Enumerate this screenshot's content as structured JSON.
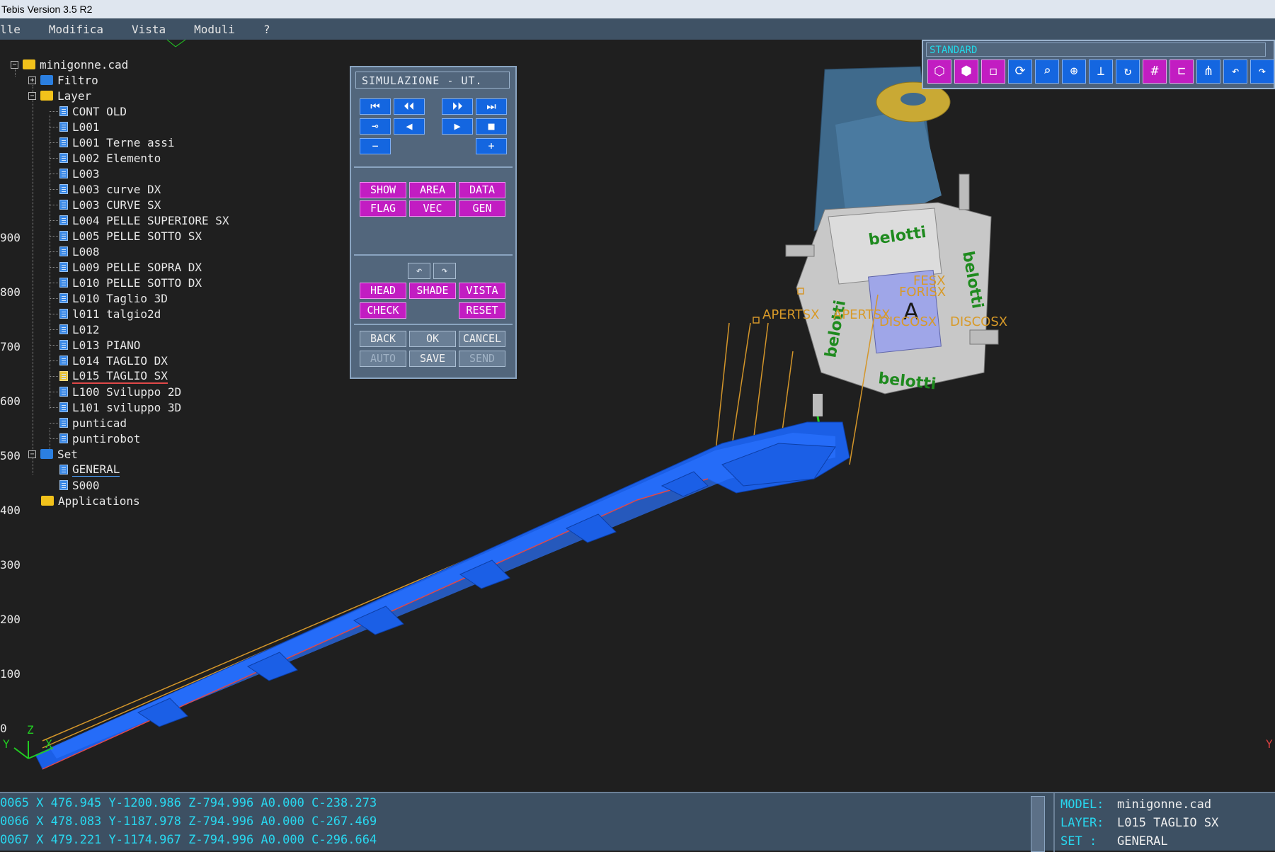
{
  "window": {
    "title": "Tebis Version 3.5 R2"
  },
  "menu": [
    "lle",
    "Modifica",
    "Vista",
    "Moduli",
    "?"
  ],
  "tree": {
    "root": "minigonne.cad",
    "filtro": "Filtro",
    "layer": "Layer",
    "layers": [
      "CONT OLD",
      "L001",
      "L001 Terne assi",
      "L002 Elemento",
      "L003",
      "L003 curve DX",
      "L003 CURVE SX",
      "L004 PELLE SUPERIORE SX",
      "L005 PELLE SOTTO SX",
      "L008",
      "L009 PELLE SOPRA DX",
      "L010 PELLE SOTTO DX",
      "L010 Taglio 3D",
      "l011 talgio2d",
      "L012",
      "L013 PIANO",
      "L014 TAGLIO DX",
      "L015 TAGLIO SX",
      "L100 Sviluppo 2D",
      "L101 sviluppo 3D",
      "punticad",
      "puntirobot"
    ],
    "set": "Set",
    "sets": [
      "GENERAL",
      "S000"
    ],
    "applications": "Applications"
  },
  "axis_ticks": [
    "900",
    "800",
    "700",
    "600",
    "500",
    "400",
    "300",
    "200",
    "100",
    "0"
  ],
  "axis_letters": {
    "z": "Z",
    "y": "Y",
    "x": "X",
    "yr": "Y"
  },
  "sim_panel": {
    "title": "SIMULAZIONE - UT.",
    "transport": [
      "⏮",
      "⏴⏴",
      "⏵⏵",
      "⏭"
    ],
    "transport2": [
      "⊸",
      "◀",
      "▶",
      "■"
    ],
    "minus": "−",
    "plus": "+",
    "row1": [
      "SHOW",
      "AREA",
      "DATA"
    ],
    "row2": [
      "FLAG",
      "VEC",
      "GEN"
    ],
    "row3": [
      "HEAD",
      "SHADE",
      "VISTA"
    ],
    "check": "CHECK",
    "reset": "RESET",
    "row4": [
      "BACK",
      "OK",
      "CANCEL"
    ],
    "row5": [
      "AUTO",
      "SAVE",
      "SEND"
    ],
    "rot_icons": [
      "↶",
      "↷"
    ]
  },
  "toolbar": {
    "title": "STANDARD",
    "icons": [
      "⬡",
      "⬢",
      "◻",
      "⟳",
      "⌕",
      "⊕",
      "⟂",
      "↻",
      "#",
      "⊏",
      "⋔",
      "↶",
      "↷"
    ]
  },
  "annotations": [
    "APERTSX",
    "APERTSX",
    "DISCOSX",
    "DISCOSX",
    "FORISX",
    "FESX"
  ],
  "machine": {
    "brand": "belotti",
    "letter": "A"
  },
  "status": {
    "lines": [
      "0065 X 476.945 Y-1200.986 Z-794.996 A0.000 C-238.273",
      "0066 X 478.083 Y-1187.978 Z-794.996 A0.000 C-267.469",
      "0067 X 479.221 Y-1174.967 Z-794.996 A0.000 C-296.664"
    ],
    "model_k": "MODEL:",
    "model_v": "minigonne.cad",
    "layer_k": "LAYER:",
    "layer_v": "L015 TAGLIO SX",
    "set_k": "SET  :",
    "set_v": "GENERAL"
  }
}
